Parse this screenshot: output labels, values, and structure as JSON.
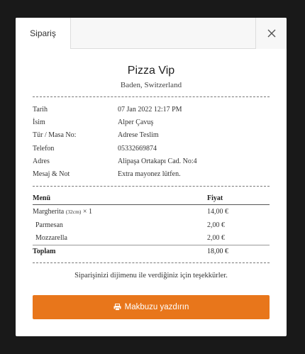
{
  "modal": {
    "tab_label": "Sipariş",
    "close_icon": "close-icon"
  },
  "receipt": {
    "restaurant": "Pizza Vip",
    "location": "Baden, Switzerland",
    "info": [
      {
        "key": "Tarih",
        "value": "07 Jan 2022 12:17 PM"
      },
      {
        "key": "İsim",
        "value": "Alper Çavuş"
      },
      {
        "key": "Tür / Masa No:",
        "value": "Adrese Teslim"
      },
      {
        "key": "Telefon",
        "value": "05332669874"
      },
      {
        "key": "Adres",
        "value": "Alipaşa Ortakapı Cad. No:4"
      },
      {
        "key": "Mesaj & Not",
        "value": "Extra mayonez lütfen."
      }
    ],
    "menu_header": {
      "item": "Menü",
      "price": "Fiyat"
    },
    "items": [
      {
        "name": "Margherita",
        "size": "(32cm)",
        "qty": "× 1",
        "price": "14,00 €"
      },
      {
        "name": "Parmesan",
        "price": "2,00 €"
      },
      {
        "name": "Mozzarella",
        "price": "2,00 €"
      }
    ],
    "total": {
      "label": "Toplam",
      "price": "18,00 €"
    },
    "thanks": "Siparişinizi dijimenu ile verdiğiniz için teşekkürler."
  },
  "print_button": {
    "label": "Makbuzu yazdırın",
    "icon": "printer-icon",
    "color": "#e8761b"
  }
}
